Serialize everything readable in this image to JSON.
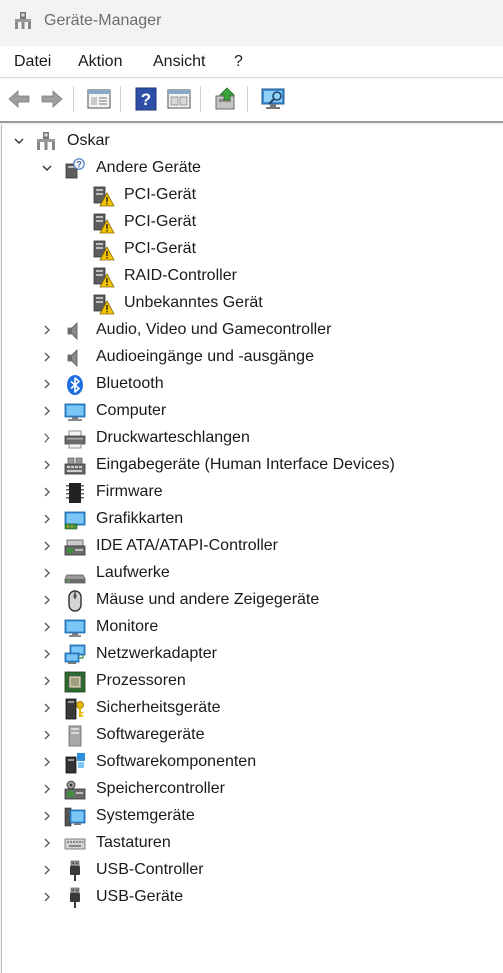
{
  "window": {
    "title": "Geräte-Manager"
  },
  "menu": [
    "Datei",
    "Aktion",
    "Ansicht",
    "?"
  ],
  "toolbar": {
    "buttons": [
      "back-arrow-icon",
      "forward-arrow-icon",
      "properties-icon",
      "help-icon",
      "view-icon",
      "update-driver-icon",
      "scan-hardware-icon"
    ]
  },
  "tree": {
    "root": "Oskar",
    "expanded_category": "Andere Geräte",
    "other_devices": [
      "PCI-Gerät",
      "PCI-Gerät",
      "PCI-Gerät",
      "RAID-Controller",
      "Unbekanntes Gerät"
    ],
    "categories": [
      {
        "label": "Audio, Video und Gamecontroller",
        "icon": "speaker-icon"
      },
      {
        "label": "Audioeingänge und -ausgänge",
        "icon": "speaker-icon"
      },
      {
        "label": "Bluetooth",
        "icon": "bluetooth-icon"
      },
      {
        "label": "Computer",
        "icon": "computer-icon"
      },
      {
        "label": "Druckwarteschlangen",
        "icon": "printer-icon"
      },
      {
        "label": "Eingabegeräte (Human Interface Devices)",
        "icon": "hid-icon"
      },
      {
        "label": "Firmware",
        "icon": "chip-icon"
      },
      {
        "label": "Grafikkarten",
        "icon": "display-adapter-icon"
      },
      {
        "label": "IDE ATA/ATAPI-Controller",
        "icon": "ide-controller-icon"
      },
      {
        "label": "Laufwerke",
        "icon": "disk-drive-icon"
      },
      {
        "label": "Mäuse und andere Zeigegeräte",
        "icon": "mouse-icon"
      },
      {
        "label": "Monitore",
        "icon": "monitor-icon"
      },
      {
        "label": "Netzwerkadapter",
        "icon": "network-adapter-icon"
      },
      {
        "label": "Prozessoren",
        "icon": "processor-icon"
      },
      {
        "label": "Sicherheitsgeräte",
        "icon": "security-device-icon"
      },
      {
        "label": "Softwaregeräte",
        "icon": "software-device-icon"
      },
      {
        "label": "Softwarekomponenten",
        "icon": "software-component-icon"
      },
      {
        "label": "Speichercontroller",
        "icon": "storage-controller-icon"
      },
      {
        "label": "Systemgeräte",
        "icon": "system-devices-icon"
      },
      {
        "label": "Tastaturen",
        "icon": "keyboard-icon"
      },
      {
        "label": "USB-Controller",
        "icon": "usb-icon"
      },
      {
        "label": "USB-Geräte",
        "icon": "usb-icon"
      }
    ]
  }
}
